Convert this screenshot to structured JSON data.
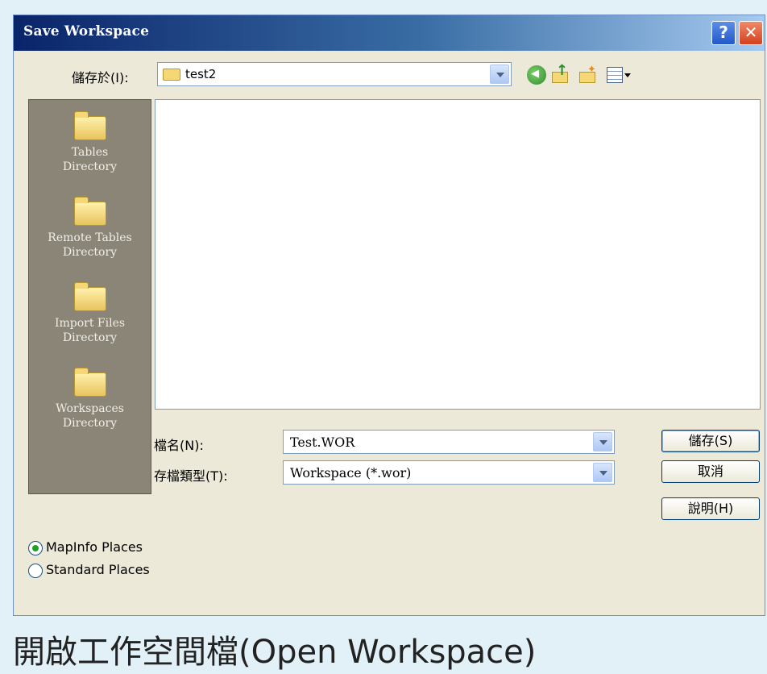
{
  "window": {
    "title": "Save Workspace",
    "help_glyph": "?",
    "close_glyph": "✕"
  },
  "save_in": {
    "label": "儲存於(I):",
    "value": "test2"
  },
  "toolbar": {
    "icons": [
      "back-icon",
      "up-folder-icon",
      "new-folder-icon",
      "views-menu-icon"
    ]
  },
  "places": [
    {
      "label_line1": "Tables",
      "label_line2": "Directory"
    },
    {
      "label_line1": "Remote Tables",
      "label_line2": "Directory"
    },
    {
      "label_line1": "Import Files",
      "label_line2": "Directory"
    },
    {
      "label_line1": "Workspaces",
      "label_line2": "Directory"
    }
  ],
  "file_name": {
    "label": "檔名(N):",
    "value": "Test.WOR"
  },
  "file_type": {
    "label": "存檔類型(T):",
    "value": "Workspace (*.wor)"
  },
  "buttons": {
    "save": "儲存(S)",
    "cancel": "取消",
    "help": "說明(H)"
  },
  "place_mode": {
    "options": [
      "MapInfo Places",
      "Standard Places"
    ],
    "selected": "MapInfo Places"
  },
  "caption": "開啟工作空間檔(Open Workspace)",
  "colors": {
    "title_gradient_start": "#0a246a",
    "dialog_bg": "#ece9d8",
    "places_bg": "#8a8576"
  }
}
